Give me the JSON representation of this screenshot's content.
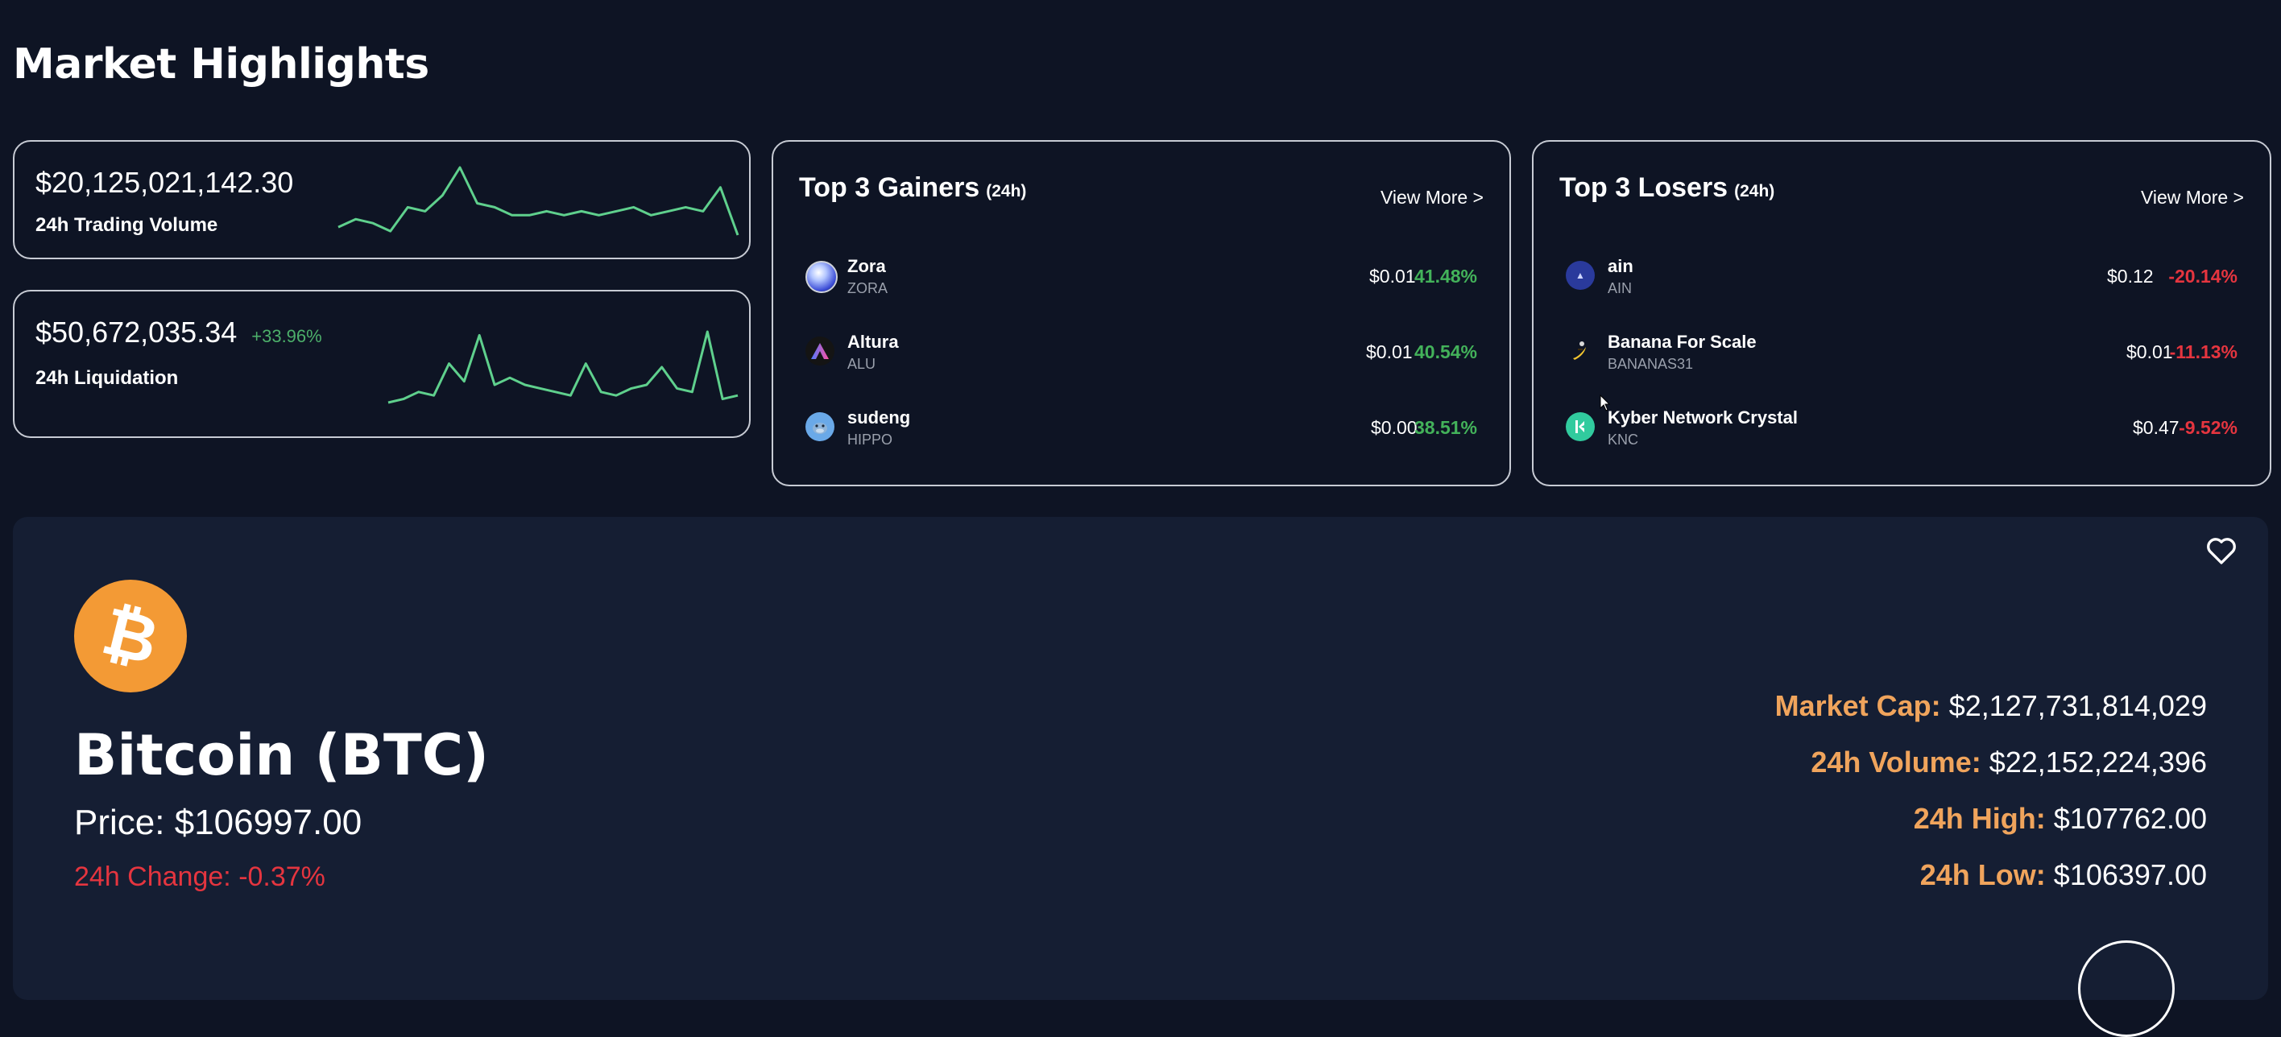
{
  "page": {
    "title": "Market Highlights"
  },
  "colors": {
    "background": "#0e1424",
    "panel": "#151e33",
    "positive": "#43b25a",
    "negative": "#e5353f",
    "accent": "#f0a45c",
    "sparkline": "#5fd08d"
  },
  "trading_volume": {
    "value": "$20,125,021,142.30",
    "label": "24h Trading Volume",
    "sparkline": [
      6,
      8,
      7,
      5,
      11,
      10,
      14,
      21,
      12,
      11,
      9,
      9,
      10,
      9,
      10,
      9,
      10,
      11,
      9,
      10,
      11,
      10,
      16,
      4
    ]
  },
  "liquidation": {
    "value": "$50,672,035.34",
    "change": "+33.96%",
    "label": "24h Liquidation",
    "sparkline": [
      3,
      4,
      6,
      5,
      14,
      9,
      22,
      8,
      10,
      8,
      7,
      6,
      5,
      14,
      6,
      5,
      7,
      8,
      13,
      7,
      6,
      23,
      4,
      5
    ]
  },
  "gainers": {
    "title": "Top 3 Gainers",
    "period": "(24h)",
    "view_more": "View More >",
    "items": [
      {
        "name": "Zora",
        "symbol": "ZORA",
        "price": "$0.01",
        "change": "41.48%",
        "icon": "zora-icon"
      },
      {
        "name": "Altura",
        "symbol": "ALU",
        "price": "$0.01",
        "change": "40.54%",
        "icon": "altura-icon"
      },
      {
        "name": "sudeng",
        "symbol": "HIPPO",
        "price": "$0.00",
        "change": "38.51%",
        "icon": "hippo-icon"
      }
    ]
  },
  "losers": {
    "title": "Top 3 Losers",
    "period": "(24h)",
    "view_more": "View More >",
    "items": [
      {
        "name": "ain",
        "symbol": "AIN",
        "price": "$0.12",
        "change": "-20.14%",
        "icon": "ain-icon"
      },
      {
        "name": "Banana For Scale",
        "symbol": "BANANAS31",
        "price": "$0.01",
        "change": "-11.13%",
        "icon": "banana-icon"
      },
      {
        "name": "Kyber Network Crystal",
        "symbol": "KNC",
        "price": "$0.47",
        "change": "-9.52%",
        "icon": "kyber-icon"
      }
    ]
  },
  "coin": {
    "name": "Bitcoin (BTC)",
    "price_label": "Price:",
    "price": "$106997.00",
    "change_label": "24h Change:",
    "change": "-0.37%",
    "logo_symbol": "₿",
    "metrics": [
      {
        "label": "Market Cap:",
        "value": "$2,127,731,814,029"
      },
      {
        "label": "24h Volume:",
        "value": "$22,152,224,396"
      },
      {
        "label": "24h High:",
        "value": "$107762.00"
      },
      {
        "label": "24h Low:",
        "value": "$106397.00"
      }
    ]
  }
}
